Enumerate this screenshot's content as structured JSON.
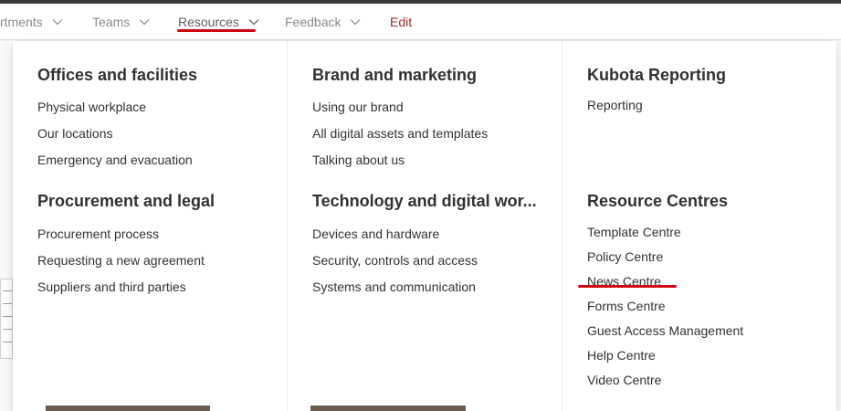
{
  "nav": {
    "items": [
      {
        "label": "rtments",
        "has_chevron": true
      },
      {
        "label": "Teams",
        "has_chevron": true
      },
      {
        "label": "Resources",
        "has_chevron": true,
        "active": true
      },
      {
        "label": "Feedback",
        "has_chevron": true
      },
      {
        "label": "Edit",
        "has_chevron": false
      }
    ],
    "accent_color": "#d1000e",
    "edit_color": "#a4262c"
  },
  "menu": {
    "columns": [
      {
        "sections": [
          {
            "heading": "Offices and facilities",
            "links": [
              "Physical workplace",
              "Our locations",
              "Emergency and evacuation"
            ]
          },
          {
            "heading": "Procurement and legal",
            "links": [
              "Procurement process",
              "Requesting a new agreement",
              "Suppliers and third parties"
            ]
          }
        ]
      },
      {
        "sections": [
          {
            "heading": "Brand and marketing",
            "links": [
              "Using our brand",
              "All digital assets and templates",
              "Talking about us"
            ]
          },
          {
            "heading": "Technology and digital wor...",
            "links": [
              "Devices and hardware",
              "Security, controls and access",
              "Systems and communication"
            ]
          }
        ]
      },
      {
        "sections": [
          {
            "heading": "Kubota Reporting",
            "links": [
              "Reporting"
            ]
          },
          {
            "heading": "Resource Centres",
            "links": [
              "Template Centre",
              "Policy Centre",
              "News Centre",
              "Forms Centre",
              "Guest Access Management",
              "Help Centre",
              "Video Centre"
            ]
          }
        ]
      }
    ],
    "highlighted_link": "News Centre"
  }
}
